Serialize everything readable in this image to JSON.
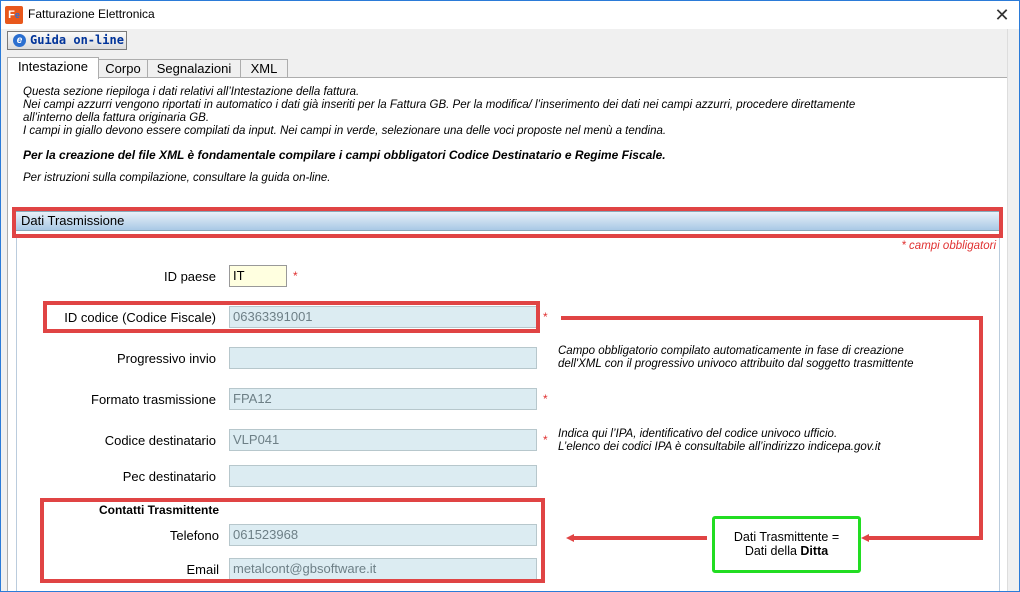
{
  "window": {
    "title": "Fatturazione Elettronica",
    "icon": "fe-app-icon",
    "close_glyph": "✕"
  },
  "toolbar": {
    "guide_label": "Guida on-line"
  },
  "tabs": [
    {
      "label": "Intestazione",
      "active": true
    },
    {
      "label": "Corpo",
      "active": false
    },
    {
      "label": "Segnalazioni",
      "active": false
    },
    {
      "label": "XML",
      "active": false
    }
  ],
  "intro": {
    "line1": "Questa sezione riepiloga i dati relativi all’Intestazione della fattura.",
    "line2": "Nei campi azzurri vengono riportati in automatico i dati già inseriti per la Fattura GB. Per la modifica/ l’inserimento dei dati nei campi azzurri, procedere direttamente",
    "line3": "all’interno della fattura originaria GB.",
    "line4": "I campi in giallo devono essere compilati da input. Nei campi in verde, selezionare una delle voci proposte nel menù a tendina.",
    "bold": "Per la creazione del file XML è fondamentale compilare i campi obbligatori Codice Destinatario e Regime Fiscale.",
    "guide": "Per istruzioni sulla compilazione, consultare la guida on-line."
  },
  "section": {
    "title": "Dati Trasmissione",
    "required_note": "* campi obbligatori"
  },
  "form": {
    "id_paese": {
      "label": "ID paese",
      "value": "IT",
      "required": "*"
    },
    "id_codice": {
      "label": "ID codice (Codice Fiscale)",
      "value": "06363391001",
      "required": "*"
    },
    "progressivo": {
      "label": "Progressivo invio",
      "value": ""
    },
    "progressivo_note_1": "Campo obbligatorio compilato automaticamente in fase di creazione",
    "progressivo_note_2": "dell'XML con il progressivo univoco attribuito dal soggetto trasmittente",
    "formato": {
      "label": "Formato trasmissione",
      "value": "FPA12",
      "required": "*"
    },
    "codice_dest": {
      "label": "Codice destinatario",
      "value": "VLP041",
      "required": "*"
    },
    "codice_dest_note_1": "Indica qui l’IPA, identificativo del codice univoco ufficio.",
    "codice_dest_note_2": "L’elenco dei codici IPA è consultabile all’indirizzo indicepa.gov.it",
    "pec": {
      "label": "Pec destinatario",
      "value": ""
    },
    "contatti_title": "Contatti Trasmittente",
    "telefono": {
      "label": "Telefono",
      "value": "061523968"
    },
    "email": {
      "label": "Email",
      "value": "metalcont@gbsoftware.it"
    }
  },
  "callout": {
    "line1": "Dati Trasmittente =",
    "line2_prefix": "Dati della ",
    "line2_bold": "Ditta"
  },
  "colors": {
    "highlight_red": "#e04444",
    "callout_green": "#22dd22",
    "field_blue": "#dcecf2",
    "field_yellow": "#ffffe0"
  }
}
